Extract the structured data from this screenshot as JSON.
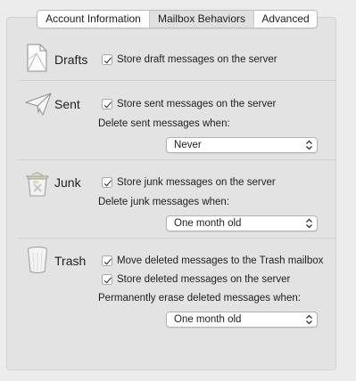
{
  "tabs": [
    {
      "label": "Account Information",
      "selected": false
    },
    {
      "label": "Mailbox Behaviors",
      "selected": true
    },
    {
      "label": "Advanced",
      "selected": false
    }
  ],
  "drafts": {
    "title": "Drafts",
    "icon": "drafts-icon",
    "store_label": "Store draft messages on the server",
    "store_checked": true
  },
  "sent": {
    "title": "Sent",
    "icon": "paper-plane-icon",
    "store_label": "Store sent messages on the server",
    "store_checked": true,
    "delete_label": "Delete sent messages when:",
    "delete_value": "Never"
  },
  "junk": {
    "title": "Junk",
    "icon": "junk-bin-icon",
    "store_label": "Store junk messages on the server",
    "store_checked": true,
    "delete_label": "Delete junk messages when:",
    "delete_value": "One month old"
  },
  "trash": {
    "title": "Trash",
    "icon": "trash-can-icon",
    "move_label": "Move deleted messages to the Trash mailbox",
    "move_checked": true,
    "store_label": "Store deleted messages on the server",
    "store_checked": true,
    "erase_label": "Permanently erase deleted messages when:",
    "erase_value": "One month old"
  }
}
